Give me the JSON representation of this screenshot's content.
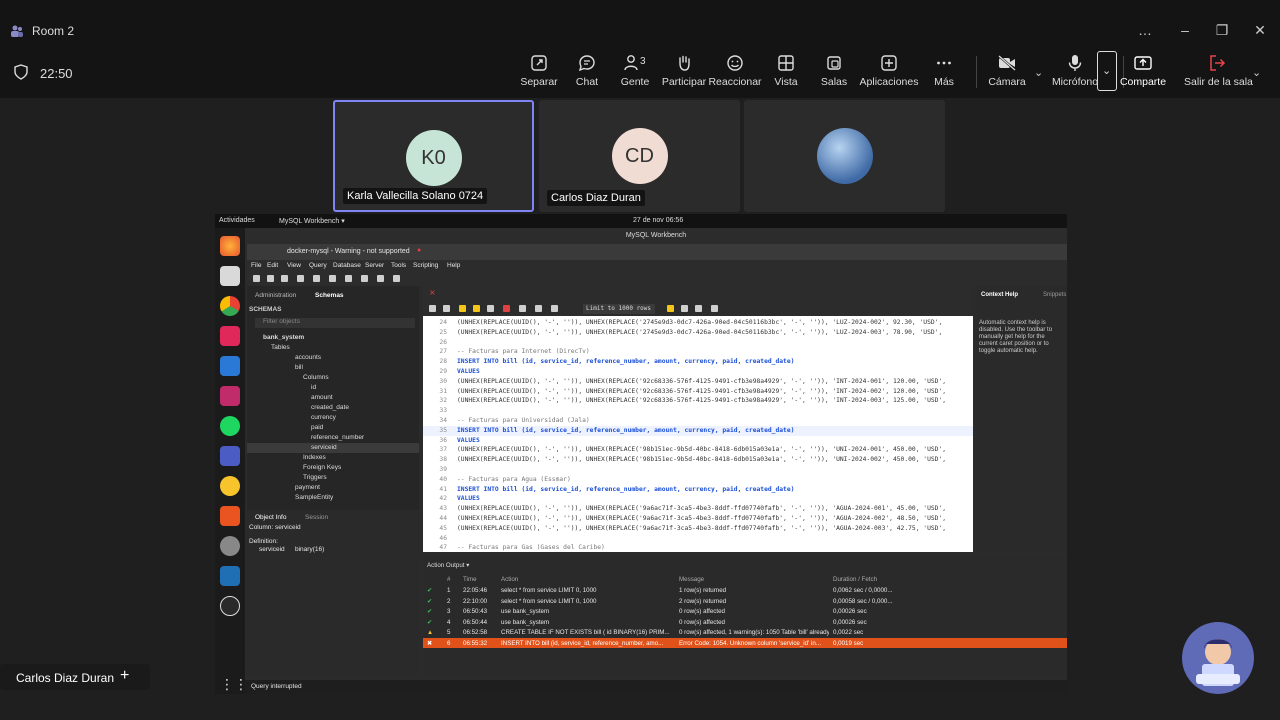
{
  "window": {
    "title": "Room 2",
    "controls": [
      "…",
      "–",
      "❐",
      "✕"
    ]
  },
  "meeting": {
    "timer": "22:50",
    "toolbar": [
      {
        "label": "Separar",
        "icon": "pop-out-icon"
      },
      {
        "label": "Chat",
        "icon": "chat-icon"
      },
      {
        "label": "Gente",
        "icon": "people-icon",
        "badge": "3"
      },
      {
        "label": "Participar",
        "icon": "raise-hand-icon"
      },
      {
        "label": "Reaccionar",
        "icon": "react-icon"
      },
      {
        "label": "Vista",
        "icon": "view-icon"
      },
      {
        "label": "Salas",
        "icon": "rooms-icon"
      },
      {
        "label": "Aplicaciones",
        "icon": "apps-icon"
      },
      {
        "label": "Más",
        "icon": "more-icon"
      },
      {
        "label": "Cámara",
        "icon": "camera-off-icon"
      },
      {
        "label": "Micrófono",
        "icon": "mic-icon"
      },
      {
        "label": "Comparte",
        "icon": "share-icon"
      },
      {
        "label": "Salir de la sala",
        "icon": "leave-icon"
      }
    ]
  },
  "participants": [
    {
      "initials": "K0",
      "name": "Karla Vallecilla Solano 0724",
      "active": true,
      "color": "#c7e5d6"
    },
    {
      "initials": "CD",
      "name": "Carlos Diaz Duran",
      "active": false,
      "color": "#f1dcd3"
    },
    {
      "initials": "",
      "name": "",
      "active": false,
      "color": "#6b8fc2"
    }
  ],
  "screen": {
    "topbar": {
      "activities": "Actividades",
      "app": "MySQL Workbench ▾",
      "datetime": "27 de nov 06:56"
    },
    "window_title": "MySQL Workbench",
    "connection_tab": "docker-mysql - Warning - not supported",
    "menu": [
      "File",
      "Edit",
      "View",
      "Query",
      "Database",
      "Server",
      "Tools",
      "Scripting",
      "Help"
    ],
    "nav_tabs": [
      "Administration",
      "Schemas"
    ],
    "schemas_label": "SCHEMAS",
    "filter_placeholder": "Filter objects",
    "tree": [
      "bank_system",
      "Tables",
      "accounts",
      "bill",
      "Columns",
      "id",
      "amount",
      "created_date",
      "currency",
      "paid",
      "reference_number",
      "serviceid",
      "Indexes",
      "Foreign Keys",
      "Triggers",
      "payment",
      "SampleEntity"
    ],
    "info_tabs": [
      "Object Info",
      "Session"
    ],
    "info": {
      "column": "Column: serviceid",
      "definition_label": "Definition:",
      "definition_name": "serviceid",
      "definition_type": "binary(16)"
    },
    "limit": "Limit to 1000 rows",
    "editor_lines": [
      {
        "n": "24",
        "text": "(UNHEX(REPLACE(UUID(), '-', '')), UNHEX(REPLACE('2745e9d3-0dc7-426a-90ed-04c50116b3bc', '-', '')), 'LUZ-2024-002', 92.30, 'USD',"
      },
      {
        "n": "25",
        "text": "(UNHEX(REPLACE(UUID(), '-', '')), UNHEX(REPLACE('2745e9d3-0dc7-426a-90ed-04c50116b3bc', '-', '')), 'LUZ-2024-003', 78.90, 'USD',"
      },
      {
        "n": "26",
        "text": ""
      },
      {
        "n": "27",
        "text": "-- Facturas para Internet (DirecTv)",
        "type": "cm"
      },
      {
        "n": "28",
        "text": "INSERT INTO bill (id, service_id, reference_number, amount, currency, paid, created_date)",
        "type": "kw"
      },
      {
        "n": "29",
        "text": "VALUES",
        "type": "kw"
      },
      {
        "n": "30",
        "text": "(UNHEX(REPLACE(UUID(), '-', '')), UNHEX(REPLACE('92c68336-576f-4125-9491-cfb3e98a4929', '-', '')), 'INT-2024-001', 120.00, 'USD',"
      },
      {
        "n": "31",
        "text": "(UNHEX(REPLACE(UUID(), '-', '')), UNHEX(REPLACE('92c68336-576f-4125-9491-cfb3e98a4929', '-', '')), 'INT-2024-002', 120.00, 'USD',"
      },
      {
        "n": "32",
        "text": "(UNHEX(REPLACE(UUID(), '-', '')), UNHEX(REPLACE('92c68336-576f-4125-9491-cfb3e98a4929', '-', '')), 'INT-2024-003', 125.00, 'USD',"
      },
      {
        "n": "33",
        "text": ""
      },
      {
        "n": "34",
        "text": "-- Facturas para Universidad (Jala)",
        "type": "cm"
      },
      {
        "n": "35",
        "text": "INSERT INTO bill (id, service_id, reference_number, amount, currency, paid, created_date)",
        "type": "kw"
      },
      {
        "n": "36",
        "text": "VALUES",
        "type": "kw"
      },
      {
        "n": "37",
        "text": "(UNHEX(REPLACE(UUID(), '-', '')), UNHEX(REPLACE('98b151ec-9b5d-40bc-8418-6db015a03e1a', '-', '')), 'UNI-2024-001', 450.00, 'USD',"
      },
      {
        "n": "38",
        "text": "(UNHEX(REPLACE(UUID(), '-', '')), UNHEX(REPLACE('98b151ec-9b5d-40bc-8418-6db015a03e1a', '-', '')), 'UNI-2024-002', 450.00, 'USD',"
      },
      {
        "n": "39",
        "text": ""
      },
      {
        "n": "40",
        "text": "-- Facturas para Agua (Essmar)",
        "type": "cm"
      },
      {
        "n": "41",
        "text": "INSERT INTO bill (id, service_id, reference_number, amount, currency, paid, created_date)",
        "type": "kw"
      },
      {
        "n": "42",
        "text": "VALUES",
        "type": "kw"
      },
      {
        "n": "43",
        "text": "(UNHEX(REPLACE(UUID(), '-', '')), UNHEX(REPLACE('9a6ac71f-3ca5-4be3-8ddf-ffd07740fafb', '-', '')), 'AGUA-2024-001', 45.00, 'USD',"
      },
      {
        "n": "44",
        "text": "(UNHEX(REPLACE(UUID(), '-', '')), UNHEX(REPLACE('9a6ac71f-3ca5-4be3-8ddf-ffd07740fafb', '-', '')), 'AGUA-2024-002', 48.50, 'USD',"
      },
      {
        "n": "45",
        "text": "(UNHEX(REPLACE(UUID(), '-', '')), UNHEX(REPLACE('9a6ac71f-3ca5-4be3-8ddf-ffd07740fafb', '-', '')), 'AGUA-2024-003', 42.75, 'USD',"
      },
      {
        "n": "46",
        "text": ""
      },
      {
        "n": "47",
        "text": "-- Facturas para Gas (Gases del Caribe)",
        "type": "cm"
      }
    ],
    "context_help": {
      "tab": "Context Help",
      "tab2": "Snippets",
      "text": "Automatic context help is disabled. Use the toolbar to manually get help for the current caret position or to toggle automatic help."
    },
    "output": {
      "selector": "Action Output ▾",
      "headers": [
        "#",
        "Time",
        "Action",
        "Message",
        "Duration / Fetch"
      ],
      "rows": [
        {
          "n": "1",
          "time": "22:05:46",
          "action": "select * from service LIMIT 0, 1000",
          "message": "1 row(s) returned",
          "duration": "0,0062 sec / 0,0000...",
          "status": "ok"
        },
        {
          "n": "2",
          "time": "22:10:00",
          "action": "select * from service LIMIT 0, 1000",
          "message": "2 row(s) returned",
          "duration": "0,00058 sec / 0,000...",
          "status": "ok"
        },
        {
          "n": "3",
          "time": "06:50:43",
          "action": "use bank_system",
          "message": "0 row(s) affected",
          "duration": "0,00026 sec",
          "status": "ok"
        },
        {
          "n": "4",
          "time": "06:50:44",
          "action": "use bank_system",
          "message": "0 row(s) affected",
          "duration": "0,00026 sec",
          "status": "ok"
        },
        {
          "n": "5",
          "time": "06:52:58",
          "action": "CREATE TABLE IF NOT EXISTS bill (   id BINARY(16) PRIM...",
          "message": "0 row(s) affected, 1 warning(s): 1050 Table 'bill' already exists",
          "duration": "0,0022 sec",
          "status": "warn"
        },
        {
          "n": "6",
          "time": "06:55:32",
          "action": "INSERT INTO bill (id, service_id, reference_number, amo...",
          "message": "Error Code: 1054. Unknown column 'service_id' in...",
          "duration": "0,0019 sec",
          "status": "error"
        }
      ]
    },
    "status_text": "Query interrupted"
  },
  "bottom": {
    "name": "Carlos Diaz Duran",
    "plus": "+"
  },
  "colors": {
    "accent": "#7f85f5",
    "error_row": "#e0521a",
    "leave": "#e8434b"
  }
}
